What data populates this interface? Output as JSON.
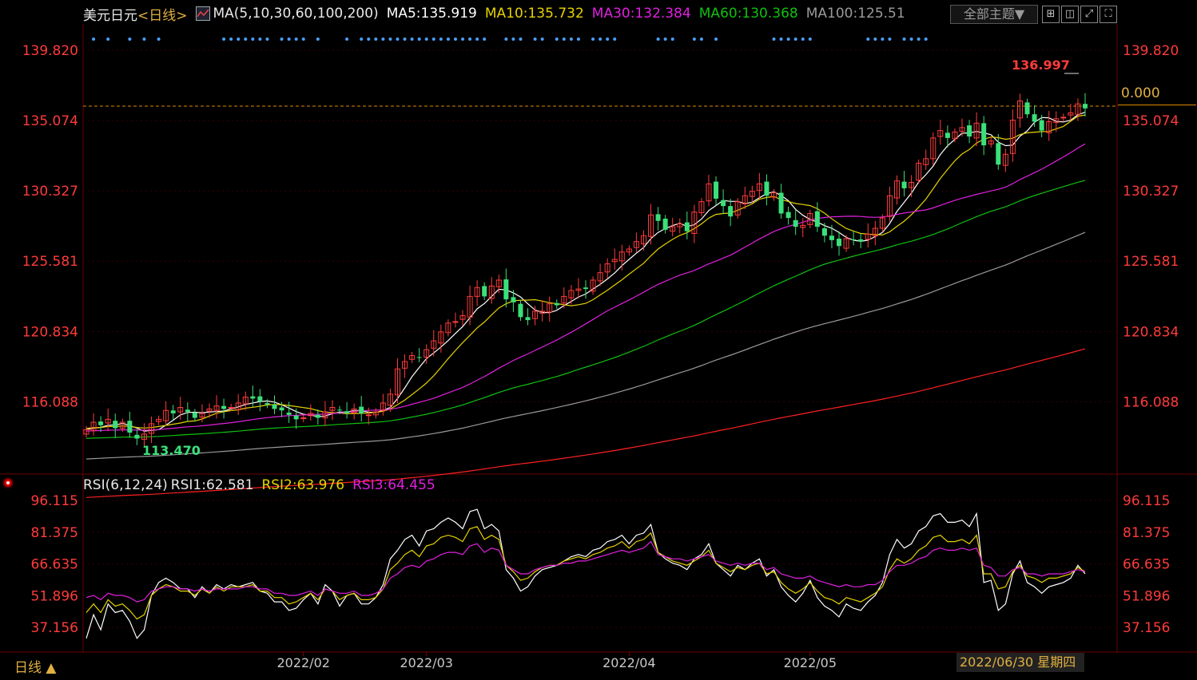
{
  "header": {
    "symbol": "美元日元",
    "period": "<日线>",
    "indicator_icon": "ma-indicator-icon",
    "ma_params": "MA(5,10,30,60,100,200)",
    "ma5": "MA5:135.919",
    "ma10": "MA10:135.732",
    "ma30": "MA30:132.384",
    "ma60": "MA60:130.368",
    "ma100": "MA100:125.51"
  },
  "toolbar": {
    "theme_label": "全部主题▼",
    "buttons": [
      "grid-layout-icon",
      "split-icon",
      "expand-icon",
      "fullscreen-icon"
    ]
  },
  "rsi_header": {
    "params": "RSI(6,12,24)",
    "rsi1": "RSI1:62.581",
    "rsi2": "RSI2:63.976",
    "rsi3": "RSI3:64.455"
  },
  "footer": {
    "period_label": "日线 ▲",
    "date_tip": "2022/06/30 星期四"
  },
  "current_price_tag": "0.000",
  "annotations": {
    "high": "136.997",
    "low": "113.470"
  },
  "colors": {
    "up": "#ff3b3b",
    "down": "#3be07a",
    "ma5": "#ffffff",
    "ma10": "#e6d200",
    "ma30": "#e020e0",
    "ma60": "#10c010",
    "ma100": "#9a9a9a",
    "ma200": "#ff2020",
    "axis_label": "#ff3b3b",
    "grid": "#3a0000"
  },
  "chart_data": [
    {
      "type": "candlestick",
      "title": "美元日元 日线",
      "ylim": [
        111.2,
        141.6
      ],
      "y_ticks": [
        139.82,
        135.074,
        130.327,
        125.581,
        120.834,
        116.088
      ],
      "y_tick_labels": [
        "139.820",
        "135.074",
        "130.327",
        "125.581",
        "120.834",
        "116.088"
      ],
      "x_ticks": [
        "2022/02",
        "2022/03",
        "2022/04",
        "2022/05",
        "2022/0"
      ],
      "ma_last": {
        "MA5": 135.919,
        "MA10": 135.732,
        "MA30": 132.384,
        "MA60": 130.368,
        "MA100": 125.51
      },
      "close": [
        114.2,
        114.7,
        114.5,
        114.9,
        114.3,
        114.7,
        114.0,
        113.6,
        113.9,
        114.6,
        114.9,
        115.5,
        115.3,
        115.7,
        115.4,
        115.0,
        115.3,
        115.6,
        115.8,
        115.6,
        115.7,
        116.0,
        116.4,
        116.3,
        116.1,
        115.9,
        115.6,
        115.5,
        115.2,
        114.9,
        115.0,
        115.3,
        115.0,
        115.4,
        115.7,
        115.5,
        115.3,
        115.6,
        115.3,
        115.2,
        115.4,
        116.0,
        116.6,
        118.3,
        118.8,
        119.2,
        119.1,
        119.6,
        120.2,
        120.8,
        121.4,
        121.5,
        121.9,
        123.2,
        123.8,
        123.2,
        123.9,
        124.3,
        123.0,
        122.8,
        121.8,
        121.6,
        122.2,
        122.2,
        122.7,
        122.6,
        123.2,
        123.6,
        123.7,
        123.7,
        124.3,
        124.8,
        125.4,
        125.7,
        126.2,
        126.4,
        126.9,
        127.3,
        128.7,
        128.3,
        127.7,
        127.9,
        128.1,
        127.6,
        128.9,
        129.6,
        130.8,
        129.8,
        129.3,
        128.6,
        129.6,
        130.0,
        130.3,
        130.8,
        130.0,
        130.2,
        128.8,
        128.5,
        127.9,
        128.0,
        128.8,
        127.9,
        127.3,
        127.0,
        126.6,
        127.1,
        127.0,
        126.9,
        127.4,
        127.8,
        128.5,
        130.0,
        131.0,
        130.5,
        130.9,
        132.2,
        132.5,
        133.9,
        134.4,
        133.9,
        134.3,
        134.6,
        134.0,
        134.9,
        133.4,
        133.7,
        132.1,
        132.8,
        135.1,
        136.4,
        135.5,
        135.0,
        134.4,
        135.0,
        135.2,
        135.3,
        135.6,
        136.2,
        135.9
      ]
    },
    {
      "type": "line",
      "title": "RSI(6,12,24)",
      "ylim": [
        26.0,
        101.0
      ],
      "y_ticks": [
        96.115,
        81.375,
        66.635,
        51.896,
        37.156
      ],
      "y_tick_labels": [
        "96.115",
        "81.375",
        "66.635",
        "51.896",
        "37.156"
      ],
      "series": [
        {
          "name": "RSI1",
          "values": [
            32,
            43,
            36,
            48,
            44,
            45,
            40,
            32,
            36,
            52,
            58,
            60,
            58,
            55,
            55,
            51,
            56,
            53,
            57,
            55,
            57,
            56,
            57,
            58,
            54,
            53,
            49,
            49,
            45,
            46,
            50,
            53,
            48,
            57,
            54,
            47,
            52,
            53,
            48,
            48,
            51,
            57,
            69,
            73,
            78,
            80,
            75,
            82,
            83,
            86,
            88,
            86,
            83,
            91,
            92,
            83,
            85,
            82,
            64,
            60,
            54,
            56,
            61,
            64,
            65,
            66,
            68,
            70,
            71,
            70,
            73,
            74,
            77,
            78,
            80,
            76,
            80,
            81,
            85,
            72,
            69,
            67,
            66,
            64,
            69,
            71,
            76,
            67,
            64,
            61,
            66,
            64,
            67,
            69,
            61,
            64,
            56,
            52,
            49,
            53,
            59,
            51,
            47,
            45,
            42,
            48,
            46,
            45,
            49,
            52,
            58,
            71,
            78,
            74,
            76,
            82,
            84,
            89,
            90,
            86,
            86,
            87,
            84,
            90,
            58,
            59,
            45,
            48,
            62,
            68,
            58,
            56,
            53,
            56,
            57,
            58,
            60,
            66,
            62
          ]
        },
        {
          "name": "RSI2",
          "values": [
            44,
            48,
            44,
            50,
            47,
            48,
            45,
            41,
            43,
            52,
            55,
            57,
            56,
            54,
            54,
            52,
            55,
            53,
            56,
            54,
            56,
            56,
            56,
            57,
            54,
            54,
            51,
            51,
            48,
            49,
            51,
            53,
            50,
            55,
            54,
            50,
            52,
            53,
            50,
            50,
            51,
            55,
            64,
            67,
            71,
            73,
            70,
            75,
            76,
            79,
            80,
            79,
            77,
            83,
            84,
            78,
            80,
            78,
            66,
            63,
            59,
            60,
            63,
            65,
            66,
            66,
            68,
            69,
            70,
            69,
            71,
            72,
            74,
            75,
            77,
            74,
            77,
            78,
            81,
            72,
            70,
            68,
            67,
            66,
            68,
            70,
            73,
            67,
            65,
            63,
            65,
            64,
            66,
            67,
            62,
            63,
            58,
            55,
            53,
            55,
            58,
            54,
            51,
            50,
            48,
            51,
            50,
            49,
            51,
            53,
            56,
            64,
            69,
            67,
            69,
            73,
            75,
            79,
            80,
            77,
            77,
            78,
            76,
            80,
            62,
            62,
            55,
            56,
            63,
            66,
            61,
            60,
            58,
            60,
            60,
            61,
            62,
            65,
            63
          ]
        },
        {
          "name": "RSI3",
          "values": [
            51,
            52,
            50,
            53,
            52,
            52,
            51,
            49,
            50,
            54,
            55,
            56,
            56,
            55,
            55,
            54,
            55,
            54,
            55,
            55,
            55,
            55,
            56,
            56,
            55,
            55,
            53,
            53,
            52,
            52,
            53,
            54,
            52,
            55,
            54,
            53,
            53,
            54,
            52,
            52,
            53,
            55,
            60,
            62,
            65,
            66,
            65,
            68,
            69,
            71,
            72,
            72,
            71,
            75,
            76,
            72,
            74,
            73,
            66,
            64,
            62,
            62,
            64,
            65,
            66,
            66,
            67,
            67,
            68,
            68,
            69,
            70,
            71,
            72,
            73,
            72,
            73,
            74,
            77,
            71,
            70,
            69,
            69,
            68,
            69,
            70,
            71,
            68,
            67,
            66,
            67,
            66,
            67,
            67,
            64,
            65,
            62,
            61,
            60,
            60,
            61,
            59,
            58,
            57,
            56,
            57,
            56,
            56,
            57,
            57,
            59,
            63,
            66,
            66,
            67,
            69,
            70,
            73,
            74,
            73,
            73,
            74,
            73,
            74,
            66,
            65,
            61,
            61,
            64,
            65,
            62,
            62,
            61,
            62,
            62,
            62,
            63,
            64,
            63
          ]
        }
      ]
    }
  ]
}
